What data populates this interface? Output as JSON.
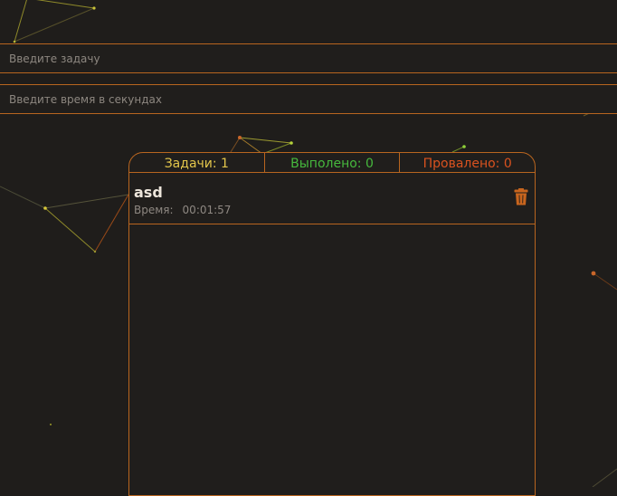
{
  "inputs": {
    "task_placeholder": "Введите задачу",
    "time_placeholder": "Введите время в секундах"
  },
  "stats": {
    "total": "Задачи: 1",
    "completed": "Выполено: 0",
    "failed": "Провалено: 0"
  },
  "tasks": [
    {
      "name": "asd",
      "time_label": "Время:",
      "time_value": "00:01:57",
      "action_icon": "trash-icon"
    }
  ],
  "colors": {
    "accent": "#b8651f",
    "background": "#1f1d1b",
    "total": "#e3c64b",
    "completed": "#46b83d",
    "failed": "#d9521f"
  }
}
